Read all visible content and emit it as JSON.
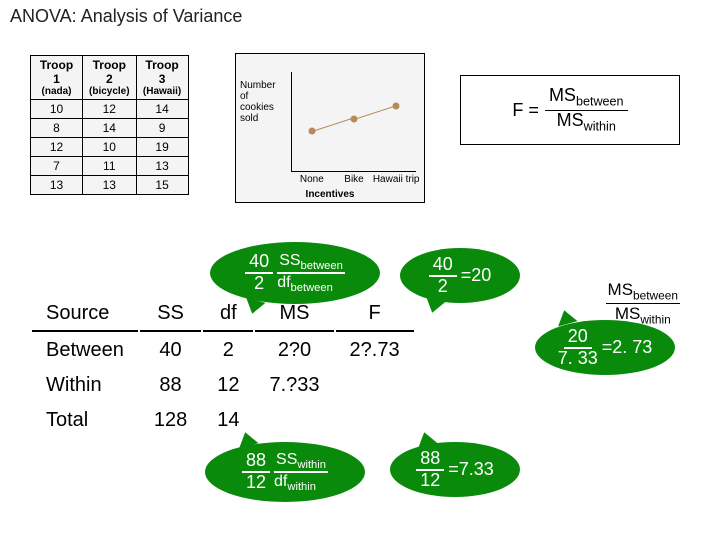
{
  "title": "ANOVA: Analysis of Variance",
  "troop_table": {
    "headers": [
      "Troop 1",
      "Troop 2",
      "Troop 3"
    ],
    "subheaders": [
      "(nada)",
      "(bicycle)",
      "(Hawaii)"
    ],
    "rows": [
      [
        "10",
        "12",
        "14"
      ],
      [
        "8",
        "14",
        "9"
      ],
      [
        "12",
        "10",
        "19"
      ],
      [
        "7",
        "11",
        "13"
      ],
      [
        "13",
        "13",
        "15"
      ]
    ]
  },
  "chart_data": {
    "type": "line",
    "categories": [
      "None",
      "Bike",
      "Hawaii trip"
    ],
    "values": [
      10,
      12,
      14
    ],
    "ylabel": "Number of cookies sold",
    "xlabel": "Incentives",
    "ylim": [
      7,
      19
    ]
  },
  "formula": {
    "lhs": "F =",
    "num_sym": "MS",
    "num_sub": "between",
    "den_sym": "MS",
    "den_sub": "within"
  },
  "anova_table": {
    "headers": [
      "Source",
      "SS",
      "df",
      "MS",
      "F"
    ],
    "rows": [
      {
        "source": "Between",
        "ss": "40",
        "df": "2",
        "ms": "2?0",
        "f": "2?.73"
      },
      {
        "source": "Within",
        "ss": "88",
        "df": "12",
        "ms": "7.?33",
        "f": ""
      },
      {
        "source": "Total",
        "ss": "128",
        "df": "14",
        "ms": "",
        "f": ""
      }
    ]
  },
  "bubble1": {
    "num": "40",
    "den": "2",
    "rnum": "SS",
    "rnum_sub": "between",
    "rden": "df",
    "rden_sub": "between"
  },
  "bubble2": {
    "num": "40",
    "den": "2",
    "res": "=20"
  },
  "bubble3": {
    "num": "88",
    "den": "12",
    "rnum": "SS",
    "rnum_sub": "within",
    "rden": "df",
    "rden_sub": "within"
  },
  "bubble4": {
    "num": "88",
    "den": "12",
    "res": "=7.33"
  },
  "bubble5": {
    "num": "20",
    "den": "7. 33",
    "res": "=2. 73"
  },
  "msf": {
    "num_sym": "MS",
    "num_sub": "between",
    "den_sym": "MS",
    "den_sub": "within"
  }
}
